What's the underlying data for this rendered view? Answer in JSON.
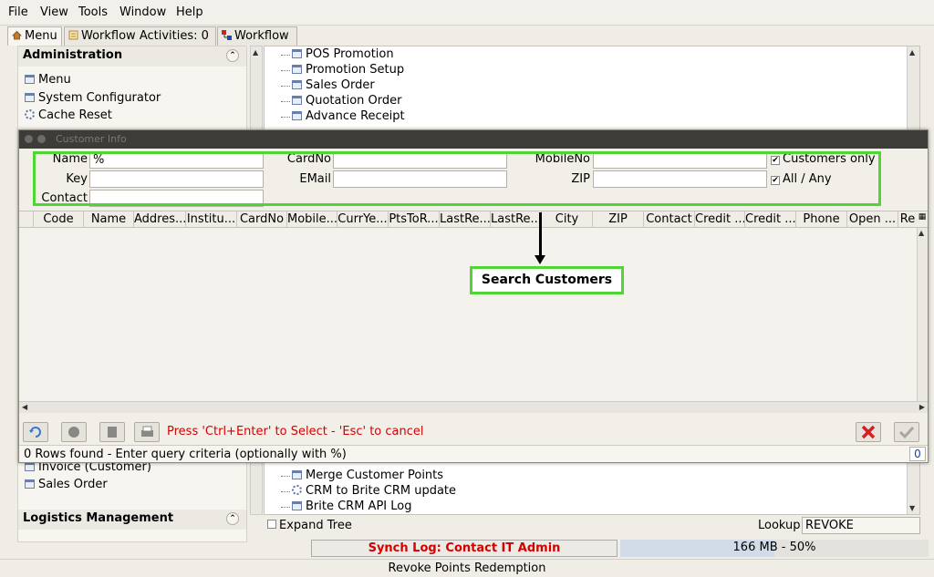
{
  "menubar": {
    "items": [
      "File",
      "View",
      "Tools",
      "Window",
      "Help"
    ]
  },
  "tabs": [
    {
      "label": "Menu",
      "icon": "home-icon"
    },
    {
      "label": "Workflow Activities: 0",
      "icon": "workflow-activities-icon"
    },
    {
      "label": "Workflow",
      "icon": "workflow-icon"
    }
  ],
  "sidebar": {
    "admin_header": "Administration",
    "admin_items": [
      "Menu",
      "System Configurator",
      "Cache Reset"
    ],
    "lower_items": [
      "Invoice (Customer)",
      "Sales Order"
    ],
    "logistics_header": "Logistics Management"
  },
  "tree": {
    "top_items": [
      "POS Promotion",
      "Promotion Setup",
      "Sales Order",
      "Quotation Order",
      "Advance Receipt"
    ],
    "bottom_items": [
      "Merge Customer Points",
      "CRM to Brite CRM update",
      "Brite CRM API Log"
    ]
  },
  "dialog": {
    "title": "Customer Info",
    "fields": {
      "name_label": "Name",
      "name_value": "%",
      "key_label": "Key",
      "contact_label": "Contact",
      "cardno_label": "CardNo",
      "email_label": "EMail",
      "mobileno_label": "MobileNo",
      "zip_label": "ZIP",
      "customers_only": "Customers only",
      "all_any": "All / Any"
    },
    "columns": [
      "Code",
      "Name",
      "Addres...",
      "Institu...",
      "CardNo",
      "Mobile...",
      "CurrYe...",
      "PtsToR...",
      "LastRe...",
      "LastRe...",
      "City",
      "ZIP",
      "Contact",
      "Credit ...",
      "Credit ...",
      "Phone",
      "Open ...",
      "Re"
    ],
    "hint": "Press 'Ctrl+Enter' to Select - 'Esc' to cancel",
    "status": "0 Rows found - Enter query criteria (optionally with %)",
    "row_count": "0"
  },
  "annotation": {
    "callout": "Search Customers",
    "accent": "#4fd636"
  },
  "bottom": {
    "expand_tree": "Expand Tree",
    "lookup_label": "Lookup",
    "lookup_value": "REVOKE",
    "sync": "Synch Log: Contact IT Admin",
    "memory": "166 MB - 50%",
    "memory_fraction": 0.5,
    "footer": "Revoke Points Redemption"
  }
}
